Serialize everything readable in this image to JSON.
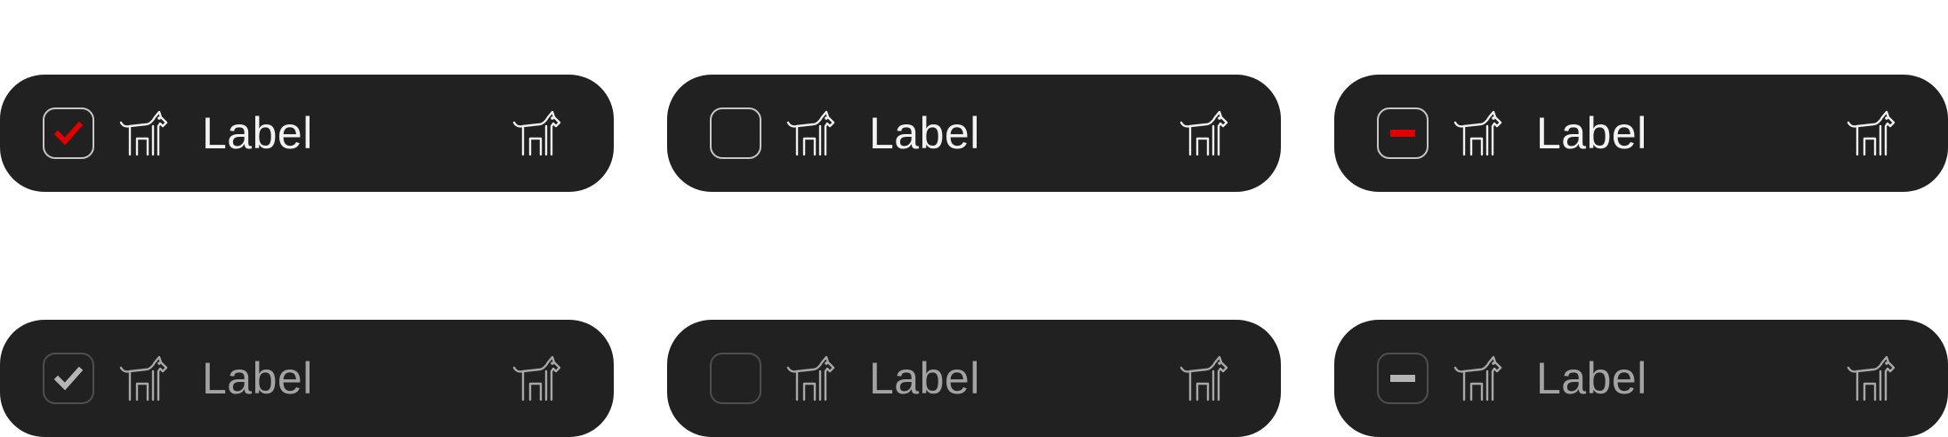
{
  "colors": {
    "surface": "#212121",
    "accent_enabled": "#e00000",
    "mark_disabled": "#b5b5b5",
    "border_enabled": "#c6c6c6",
    "border_disabled": "#4e4e4e"
  },
  "items": [
    {
      "label": "Label",
      "state": "checked",
      "enabled": true,
      "icon": "dog-icon"
    },
    {
      "label": "Label",
      "state": "unchecked",
      "enabled": true,
      "icon": "dog-icon"
    },
    {
      "label": "Label",
      "state": "indeterminate",
      "enabled": true,
      "icon": "dog-icon"
    },
    {
      "label": "Label",
      "state": "checked",
      "enabled": false,
      "icon": "dog-icon"
    },
    {
      "label": "Label",
      "state": "unchecked",
      "enabled": false,
      "icon": "dog-icon"
    },
    {
      "label": "Label",
      "state": "indeterminate",
      "enabled": false,
      "icon": "dog-icon"
    }
  ]
}
